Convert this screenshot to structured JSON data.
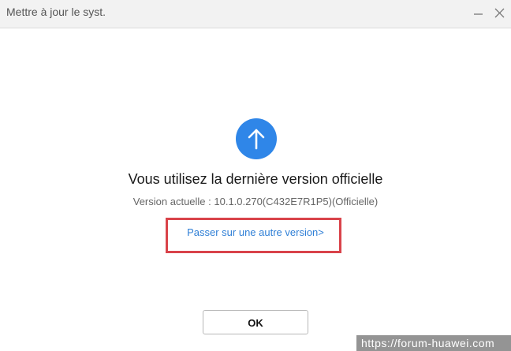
{
  "window": {
    "title": "Mettre à jour le syst."
  },
  "titlebar": {
    "minimize_icon": "minimize-icon",
    "close_icon": "close-icon"
  },
  "main": {
    "icon": "arrow-up-icon",
    "headline": "Vous utilisez la dernière version officielle",
    "version_text": "Version actuelle : 10.1.0.270(C432E7R1P5)(Officielle)",
    "switch_link": "Passer sur une autre version>",
    "ok_label": "OK"
  },
  "watermark": {
    "text": "https://forum-huawei.com"
  },
  "colors": {
    "accent_blue": "#2f86e8",
    "link_blue": "#2f7fd6",
    "highlight_red": "#d9434a",
    "titlebar_bg": "#f2f2f2"
  }
}
